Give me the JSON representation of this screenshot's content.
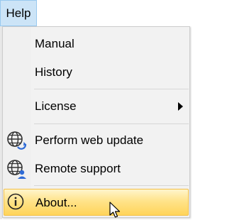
{
  "menubar": {
    "help_label": "Help"
  },
  "menu": {
    "items": [
      {
        "label": "Manual",
        "icon": "none"
      },
      {
        "label": "History",
        "icon": "none"
      },
      {
        "label": "License",
        "icon": "submenu-arrow"
      },
      {
        "label": "Perform web update",
        "icon": "globe-update-icon"
      },
      {
        "label": "Remote support",
        "icon": "globe-user-icon"
      },
      {
        "label": "About...",
        "icon": "info-icon",
        "highlighted": true
      }
    ]
  },
  "colors": {
    "menu_bg": "#f2f2f2",
    "help_button_bg": "#cce4f7",
    "highlight_top": "#fff5cc",
    "highlight_bottom": "#ffd45a",
    "highlight_border": "#f3c047",
    "icon_blue": "#2f6bd6"
  }
}
